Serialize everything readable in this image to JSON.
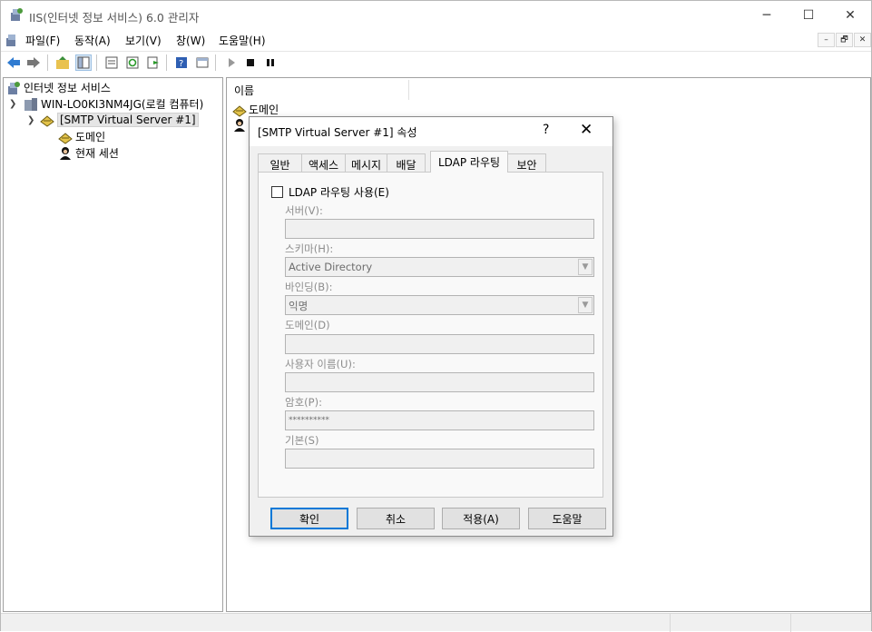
{
  "window": {
    "title": "IIS(인터넷 정보 서비스) 6.0 관리자",
    "controls": {
      "minimize": "─",
      "maximize": "☐",
      "close": "✕"
    }
  },
  "menubar": {
    "items": [
      "파일(F)",
      "동작(A)",
      "보기(V)",
      "창(W)",
      "도움말(H)"
    ],
    "mdi_controls": [
      "–",
      "🗗",
      "✕"
    ]
  },
  "toolbar": {
    "buttons": [
      "back-icon",
      "forward-icon",
      "up-folder-icon",
      "show-hide-tree-icon",
      "properties-icon",
      "refresh-icon",
      "export-icon",
      "help-icon",
      "console-icon",
      "play-icon",
      "stop-icon",
      "pause-icon"
    ]
  },
  "tree": {
    "root": "인터넷 정보 서비스",
    "computer": "WIN-LO0KI3NM4JG(로컬 컴퓨터)",
    "server": "[SMTP Virtual Server #1]",
    "children": [
      "도메인",
      "현재 세션"
    ]
  },
  "list": {
    "column_header": "이름",
    "rows": [
      "도메인",
      ""
    ]
  },
  "dialog": {
    "title": "[SMTP Virtual Server #1] 속성",
    "help": "?",
    "close": "✕",
    "tabs": [
      "일반",
      "액세스",
      "메시지",
      "배달",
      "LDAP 라우팅",
      "보안"
    ],
    "active_tab": "LDAP 라우팅",
    "enable_checkbox": {
      "label": "LDAP 라우팅 사용(E)",
      "checked": false
    },
    "fields": {
      "server": {
        "label": "서버(V):",
        "value": ""
      },
      "schema": {
        "label": "스키마(H):",
        "value": "Active Directory"
      },
      "binding": {
        "label": "바인딩(B):",
        "value": "익명"
      },
      "domain": {
        "label": "도메인(D)",
        "value": ""
      },
      "username": {
        "label": "사용자 이름(U):",
        "value": ""
      },
      "password": {
        "label": "암호(P):",
        "value": "**********"
      },
      "base": {
        "label": "기본(S)",
        "value": ""
      }
    },
    "buttons": {
      "ok": "확인",
      "cancel": "취소",
      "apply": "적용(A)",
      "help": "도움말"
    }
  },
  "colors": {
    "accent": "#0078d7",
    "disabled_text": "#8d8d8d"
  }
}
